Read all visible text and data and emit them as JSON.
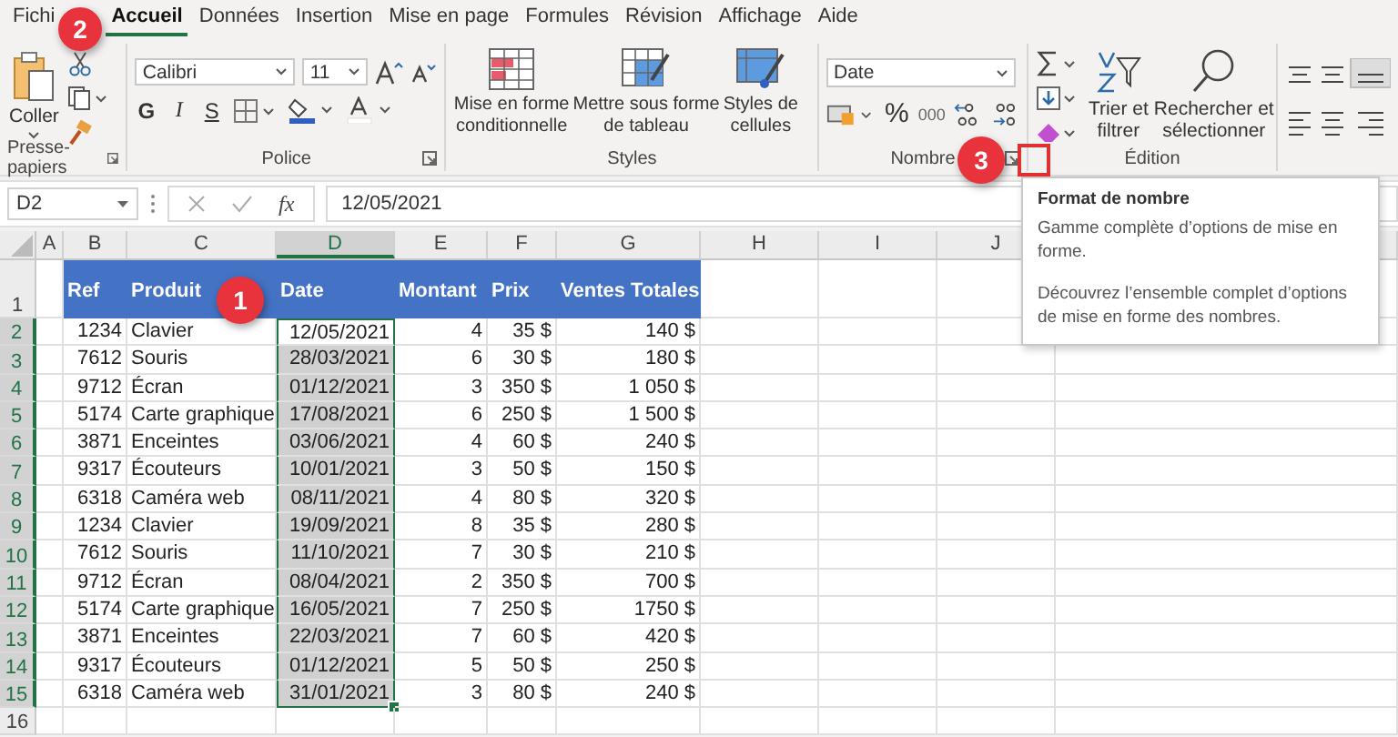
{
  "tabs": [
    {
      "label": "Fichi",
      "selected": false
    },
    {
      "label": "Accueil",
      "selected": true
    },
    {
      "label": "Données",
      "selected": false
    },
    {
      "label": "Insertion",
      "selected": false
    },
    {
      "label": "Mise en page",
      "selected": false
    },
    {
      "label": "Formules",
      "selected": false
    },
    {
      "label": "Révision",
      "selected": false
    },
    {
      "label": "Affichage",
      "selected": false
    },
    {
      "label": "Aide",
      "selected": false
    }
  ],
  "ribbon": {
    "clipboard": {
      "paste": "Coller",
      "group": "Presse-papiers"
    },
    "font": {
      "family": "Calibri",
      "size": "11",
      "bold": "G",
      "italic": "I",
      "underline": "S",
      "group": "Police"
    },
    "styles": {
      "buttons": [
        {
          "kind": "conditional",
          "lines": [
            "Mise en forme",
            "conditionnelle"
          ]
        },
        {
          "kind": "table",
          "lines": [
            "Mettre sous forme",
            "de tableau"
          ]
        },
        {
          "kind": "cell",
          "lines": [
            "Styles de",
            "cellules"
          ]
        }
      ],
      "group": "Styles"
    },
    "number": {
      "format": "Date",
      "percent": "%",
      "thousands": "000",
      "group": "Nombre"
    },
    "editing": {
      "sort": [
        "Trier et",
        "filtrer"
      ],
      "find": [
        "Rechercher et",
        "sélectionner"
      ],
      "group": "Édition"
    }
  },
  "formula_bar": {
    "name_box": "D2",
    "fx": "fx",
    "value": "12/05/2021"
  },
  "sheet": {
    "columns": [
      {
        "label": "A",
        "selected": false
      },
      {
        "label": "B",
        "selected": false
      },
      {
        "label": "C",
        "selected": false
      },
      {
        "label": "D",
        "selected": true
      },
      {
        "label": "E",
        "selected": false
      },
      {
        "label": "F",
        "selected": false
      },
      {
        "label": "G",
        "selected": false
      },
      {
        "label": "H",
        "selected": false
      },
      {
        "label": "I",
        "selected": false
      },
      {
        "label": "J",
        "selected": false
      }
    ],
    "header_row": {
      "number": "1",
      "cells": [
        "",
        "Ref",
        "Produit",
        "Date",
        "Montant",
        "Prix",
        "Ventes Totales"
      ]
    },
    "rows": [
      {
        "number": "2",
        "selected": true,
        "active": true,
        "cells": [
          "",
          "1234",
          "Clavier",
          "12/05/2021",
          "4",
          "35 $",
          "140 $"
        ]
      },
      {
        "number": "3",
        "selected": true,
        "active": false,
        "cells": [
          "",
          "7612",
          "Souris",
          "28/03/2021",
          "6",
          "30 $",
          "180 $"
        ]
      },
      {
        "number": "4",
        "selected": true,
        "active": false,
        "cells": [
          "",
          "9712",
          "Écran",
          "01/12/2021",
          "3",
          "350 $",
          "1 050 $"
        ]
      },
      {
        "number": "5",
        "selected": true,
        "active": false,
        "cells": [
          "",
          "5174",
          "Carte graphique",
          "17/08/2021",
          "6",
          "250 $",
          "1 500 $"
        ]
      },
      {
        "number": "6",
        "selected": true,
        "active": false,
        "cells": [
          "",
          "3871",
          "Enceintes",
          "03/06/2021",
          "4",
          "60 $",
          "240 $"
        ]
      },
      {
        "number": "7",
        "selected": true,
        "active": false,
        "cells": [
          "",
          "9317",
          "Écouteurs",
          "10/01/2021",
          "3",
          "50 $",
          "150 $"
        ]
      },
      {
        "number": "8",
        "selected": true,
        "active": false,
        "cells": [
          "",
          "6318",
          "Caméra web",
          "08/11/2021",
          "4",
          "80 $",
          "320 $"
        ]
      },
      {
        "number": "9",
        "selected": true,
        "active": false,
        "cells": [
          "",
          "1234",
          "Clavier",
          "19/09/2021",
          "8",
          "35 $",
          "280 $"
        ]
      },
      {
        "number": "10",
        "selected": true,
        "active": false,
        "cells": [
          "",
          "7612",
          "Souris",
          "11/10/2021",
          "7",
          "30 $",
          "210 $"
        ]
      },
      {
        "number": "11",
        "selected": true,
        "active": false,
        "cells": [
          "",
          "9712",
          "Écran",
          "08/04/2021",
          "2",
          "350 $",
          "700 $"
        ]
      },
      {
        "number": "12",
        "selected": true,
        "active": false,
        "cells": [
          "",
          "5174",
          "Carte graphique",
          "16/05/2021",
          "7",
          "250 $",
          "1750 $"
        ]
      },
      {
        "number": "13",
        "selected": true,
        "active": false,
        "cells": [
          "",
          "3871",
          "Enceintes",
          "22/03/2021",
          "7",
          "60 $",
          "420 $"
        ]
      },
      {
        "number": "14",
        "selected": true,
        "active": false,
        "cells": [
          "",
          "9317",
          "Écouteurs",
          "01/12/2021",
          "5",
          "50 $",
          "250 $"
        ]
      },
      {
        "number": "15",
        "selected": true,
        "active": false,
        "cells": [
          "",
          "6318",
          "Caméra web",
          "31/01/2021",
          "3",
          "80 $",
          "240 $"
        ]
      }
    ],
    "empty_rows": [
      "16"
    ]
  },
  "tooltip": {
    "title": "Format de nombre",
    "paragraphs": [
      "Gamme complète d’options de mise en forme.",
      "Découvrez l’ensemble complet d’options de mise en forme des nombres."
    ]
  },
  "badges": [
    "1",
    "2",
    "3"
  ]
}
